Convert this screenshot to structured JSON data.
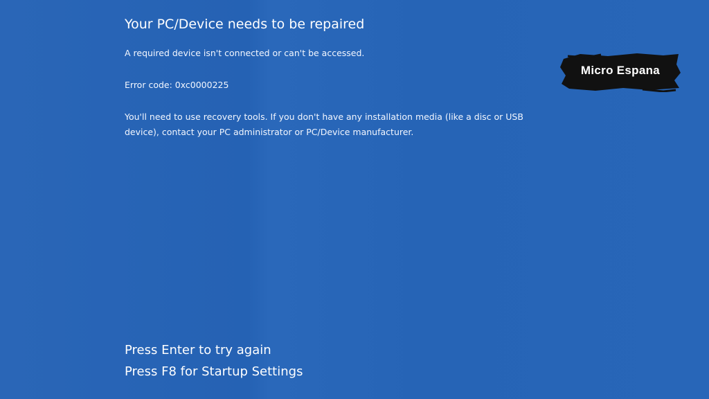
{
  "error_screen": {
    "headline": "Your PC/Device needs to be repaired",
    "message": "A required device isn't connected or can't be accessed.",
    "error_code": "Error code: 0xc0000225",
    "recovery_line_1": "You'll need to use recovery tools. If you don't have any installation media (like a disc or USB",
    "recovery_line_2": "device), contact your PC administrator or PC/Device manufacturer."
  },
  "actions": {
    "enter_text": "Press Enter to try again",
    "f8_text": "Press F8 for Startup Settings"
  },
  "watermark": {
    "text": "Micro Espana"
  },
  "colors": {
    "background": "#2563b4",
    "text": "#ffffff",
    "watermark_bg": "#111111"
  }
}
